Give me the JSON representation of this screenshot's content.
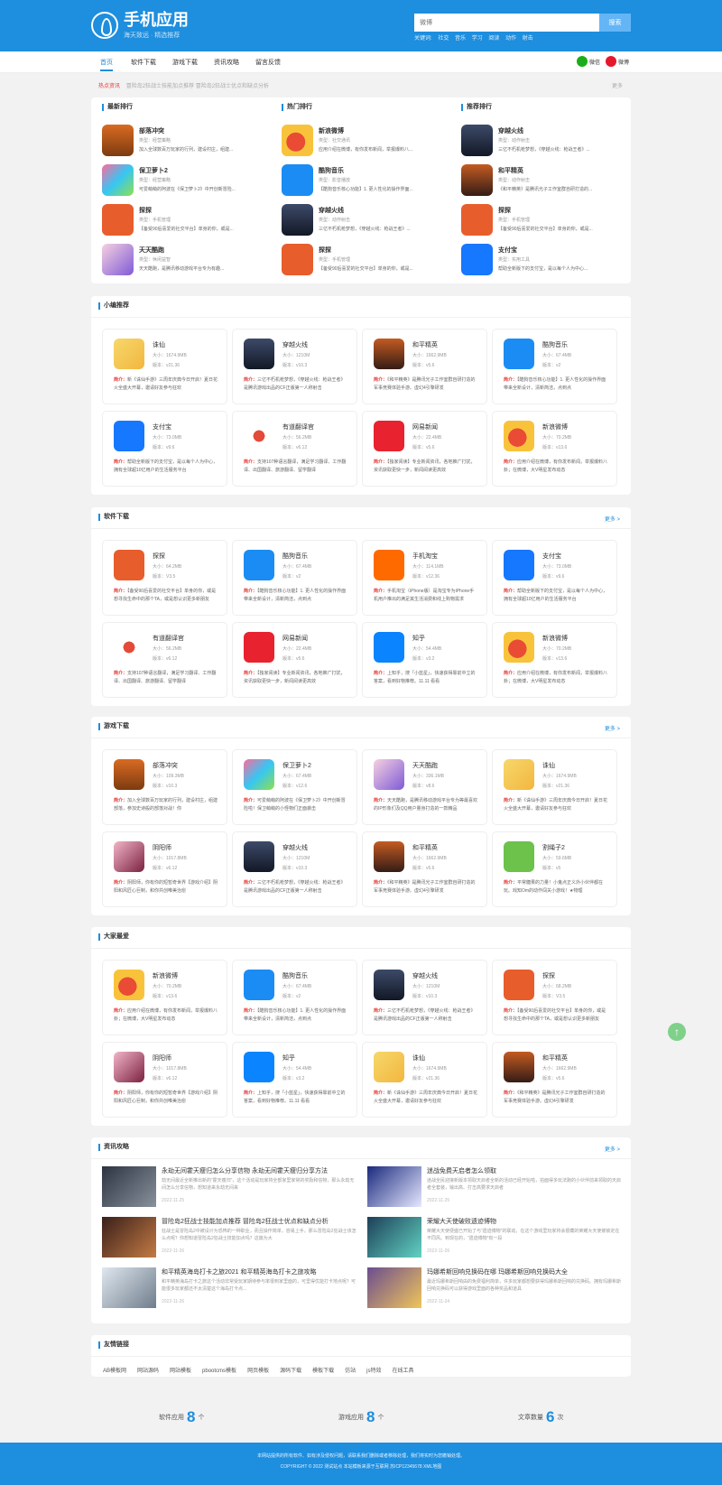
{
  "colors": {
    "brand": "#1e8ede",
    "accent": "#e53935",
    "panel": "#ffffff"
  },
  "header": {
    "title": "手机应用",
    "slogan": "海天致远 · 精选推荐",
    "search_placeholder": "微博",
    "search_button": "搜索",
    "hotwords_label": "关键词:",
    "hotwords": [
      "社交",
      "音乐",
      "学习",
      "阅读",
      "动作",
      "射击"
    ]
  },
  "nav": {
    "items": [
      "首页",
      "软件下载",
      "游戏下载",
      "资讯攻略",
      "留言反馈"
    ],
    "wechat_label": "微信",
    "weibo_label": "微博"
  },
  "notice": {
    "label": "热点资讯",
    "text": "冒险岛2狂战士技能加点推荐 冒险岛2狂战士优点和缺点分析",
    "more": "更多"
  },
  "rankings": {
    "columns": [
      {
        "title": "最新排行",
        "items": [
          {
            "name": "部落冲突",
            "category": "类型：经营策略",
            "desc": "加入全球数百万玩家的行列，建设村庄，组建..."
          },
          {
            "name": "保卫萝卜2",
            "category": "类型：经营策略",
            "desc": "可爱萌萌的阿波在《保卫萝卜2》中开创新冒险..."
          },
          {
            "name": "探探",
            "category": "类型：手机管理",
            "desc": "【备受90后喜爱的社交平台】单身的你，或是..."
          },
          {
            "name": "天天酷跑",
            "category": "类型：休闲益智",
            "desc": "天天酷跑，是腾讯移动游戏平台专为有趣..."
          }
        ]
      },
      {
        "title": "热门排行",
        "items": [
          {
            "name": "新浪微博",
            "category": "类型：社交通讯",
            "desc": "应用介绍在微博，有你发布新闻，举报爆料八..."
          },
          {
            "name": "酷狗音乐",
            "category": "类型：影音播放",
            "desc": "【酷狗音乐核心功能】1. 更人性化的操作界面..."
          },
          {
            "name": "穿越火线",
            "category": "类型：动作射击",
            "desc": "三亿不朽机枪梦想，《穿越火线：枪战王者》..."
          },
          {
            "name": "探探",
            "category": "类型：手机管理",
            "desc": "【备受90后喜爱的社交平台】单身的你，或是..."
          }
        ]
      },
      {
        "title": "推荐排行",
        "items": [
          {
            "name": "穿越火线",
            "category": "类型：动作射击",
            "desc": "三亿不朽机枪梦想，《穿越火线：枪战王者》..."
          },
          {
            "name": "和平精英",
            "category": "类型：动作射击",
            "desc": "《和平精英》是腾讯光子工作室群自研打造的..."
          },
          {
            "name": "探探",
            "category": "类型：手机管理",
            "desc": "【备受90后喜爱的社交平台】单身的你，或是..."
          },
          {
            "name": "支付宝",
            "category": "类型：实用工具",
            "desc": "帮助全新版下的支付宝，是以每个人为中心..."
          }
        ]
      }
    ]
  },
  "recommend": {
    "title": "小编推荐",
    "items": [
      {
        "name": "诛仙",
        "size": "大小：1674.9MB",
        "version": "版本：v21.36",
        "desc": "新《诛仙手游》三周年庆典今日开启！夏日花火全盛大开幕，邀请好友参与狂欢"
      },
      {
        "name": "穿越火线",
        "size": "大小：1210M",
        "version": "版本：v10.3",
        "desc": "三亿不朽机枪梦想，《穿越火线：枪战王者》是腾讯游戏出品的CF正版第一人称射击"
      },
      {
        "name": "和平精英",
        "size": "大小：1662.9MB",
        "version": "版本：v5.6",
        "desc": "《和平精英》是腾讯光子工作室群自研打造的军事竞赛体验手游。虚幻4引擎研发"
      },
      {
        "name": "酷狗音乐",
        "size": "大小：67.4MB",
        "version": "版本：v2",
        "desc": "【酷狗音乐核心功能】1. 更人性化的操作界面带来全新设计，清新简洁，点到点"
      },
      {
        "name": "支付宝",
        "size": "大小：73.0MB",
        "version": "版本：v9.6",
        "desc": "帮助全新版下的支付宝，是以每个人为中心，拥有全球超10亿用户的生活服务平台"
      },
      {
        "name": "有道翻译官",
        "size": "大小：56.2MB",
        "version": "版本：v6.12",
        "desc": "支持107种语言翻译，满足学习翻译、工作翻译、出国翻译、旅游翻译、留学翻译"
      },
      {
        "name": "网易新闻",
        "size": "大小：22.4MB",
        "version": "版本：v5.6",
        "desc": "【独家阅读】专业新闻资讯，各地推广打扰，资讯获取更快一步，新闻阅读更高效"
      },
      {
        "name": "新浪微博",
        "size": "大小：70.2MB",
        "version": "版本：v13.6",
        "desc": "应用介绍在微博，有你发布新闻，举报爆料八卦；在微博，大V明星发布动态"
      }
    ]
  },
  "software": {
    "title": "软件下载",
    "more": "更多 >",
    "items": [
      {
        "name": "探探",
        "size": "大小：64.2MB",
        "version": "版本：V3.5",
        "desc": "【备受90后喜爱的社交平台】单身的你，或是想寻找生命中的那个TA，或是想认识更多新朋友"
      },
      {
        "name": "酷狗音乐",
        "size": "大小：67.4MB",
        "version": "版本：v2",
        "desc": "【酷狗音乐核心功能】1. 更人性化的操作界面带来全新设计，清新简洁，点到点"
      },
      {
        "name": "手机淘宝",
        "size": "大小：114.1MB",
        "version": "版本：v12.36",
        "desc": "手机淘宝（iPhone版）是淘宝专为iPhone手机用户推出的满足其生活消费和线上购物需求"
      },
      {
        "name": "支付宝",
        "size": "大小：73.0MB",
        "version": "版本：v9.6",
        "desc": "帮助全新版下的支付宝，是以每个人为中心，拥有全球超10亿用户的生活服务平台"
      },
      {
        "name": "有道翻译官",
        "size": "大小：56.2MB",
        "version": "版本：v6.12",
        "desc": "支持107种语言翻译，满足学习翻译、工作翻译、出国翻译、旅游翻译、留学翻译"
      },
      {
        "name": "网易新闻",
        "size": "大小：22.4MB",
        "version": "版本：v5.6",
        "desc": "【独家阅读】专业新闻资讯，各地推广打扰，资讯获取更快一步，新闻阅读更高效"
      },
      {
        "name": "知乎",
        "size": "大小：54.4MB",
        "version": "版本：v3.2",
        "desc": "上知乎，搜「小蓝星」，快速获得靠前中立的答案，看到好物推荐。11.11 看看"
      },
      {
        "name": "新浪微博",
        "size": "大小：70.2MB",
        "version": "版本：v13.6",
        "desc": "应用介绍在微博，有你发布新闻，举报爆料八卦；在微博，大V明星发布动态"
      }
    ]
  },
  "games": {
    "title": "游戏下载",
    "more": "更多 >",
    "items": [
      {
        "name": "部落冲突",
        "size": "大小：109.3MB",
        "version": "版本：v10.3",
        "desc": "加入全球数百万玩家的行列，建设村庄，组建部落，参加史诗般的部落对战！你"
      },
      {
        "name": "保卫萝卜2",
        "size": "大小：67.4MB",
        "version": "版本：v12.6",
        "desc": "可爱萌萌的阿波在《保卫萝卜2》中开创新冒险啦！保卫萌萌的小怪物们正面袭击"
      },
      {
        "name": "天天酷跑",
        "size": "大小：336.1MB",
        "version": "版本：v8.6",
        "desc": "天天酷跑，是腾讯移动游戏平台专为等最喜欢的IP形象们及QQ用户量身打造的一款精品"
      },
      {
        "name": "诛仙",
        "size": "大小：1674.9MB",
        "version": "版本：v21.36",
        "desc": "新《诛仙手游》三周年庆典今日开启！夏日花火全盛大开幕，邀请好友参与狂欢"
      },
      {
        "name": "阴阳师",
        "size": "大小：1017.8MB",
        "version": "版本：v6.12",
        "desc": "阴阳师，你有你的短暂奇世界【游戏介绍】阴阳和风匠心巨制，和你共创唯美治愈"
      },
      {
        "name": "穿越火线",
        "size": "大小：1210M",
        "version": "版本：v10.3",
        "desc": "三亿不朽机枪梦想，《穿越火线：枪战王者》是腾讯游戏出品的CF正版第一人称射击"
      },
      {
        "name": "和平精英",
        "size": "大小：1662.9MB",
        "version": "版本：v5.6",
        "desc": "《和平精英》是腾讯光子工作室群自研打造的军事竞赛体验手游。虚幻4引擎研发"
      },
      {
        "name": "割绳子2",
        "size": "大小：59.6MB",
        "version": "版本：v5",
        "desc": "平常糖果的力量！小鬼点正义外小伙伴都在玩。戏知Om的动作闯关小游戏！★物理"
      }
    ]
  },
  "popular": {
    "title": "大家最爱",
    "items": [
      {
        "name": "新浪微博",
        "size": "大小：70.2MB",
        "version": "版本：v13.6",
        "desc": "应用介绍在微博，有你发布新闻，举报爆料八卦；在微博，大V明星发布动态"
      },
      {
        "name": "酷狗音乐",
        "size": "大小：67.4MB",
        "version": "版本：v2",
        "desc": "【酷狗音乐核心功能】1. 更人性化的操作界面带来全新设计，清新简洁，点到点"
      },
      {
        "name": "穿越火线",
        "size": "大小：1210M",
        "version": "版本：v10.3",
        "desc": "三亿不朽机枪梦想，《穿越火线：枪战王者》是腾讯游戏出品的CF正版第一人称射击"
      },
      {
        "name": "探探",
        "size": "大小：68.2MB",
        "version": "版本：V3.5",
        "desc": "【备受90后喜爱的社交平台】单身的你，或是想寻找生命中的那个TA，或是想认识更多新朋友"
      },
      {
        "name": "阴阳师",
        "size": "大小：1017.8MB",
        "version": "版本：v6.12",
        "desc": "阴阳师，你有你的短暂奇世界【游戏介绍】阴阳和风匠心巨制，和你共创唯美治愈"
      },
      {
        "name": "知乎",
        "size": "大小：54.4MB",
        "version": "版本：v3.2",
        "desc": "上知乎，搜「小蓝星」，快速获得靠前中立的答案，看到好物推荐。11.11 看看"
      },
      {
        "name": "诛仙",
        "size": "大小：1674.9MB",
        "version": "版本：v21.36",
        "desc": "新《诛仙手游》三周年庆典今日开启！夏日花火全盛大开幕，邀请好友参与狂欢"
      },
      {
        "name": "和平精英",
        "size": "大小：1662.9MB",
        "version": "版本：v5.6",
        "desc": "《和平精英》是腾讯光子工作室群自研打造的军事竞赛体验手游。虚幻4引擎研发"
      }
    ]
  },
  "news": {
    "title": "资讯攻略",
    "more": "更多 >",
    "items": [
      {
        "title": "永劫无间霍天瘦归怎么分享信物 永劫无间霍天瘦归分享方法",
        "desc": "劫无间最近全新推出新的“霍天瘦归”，这个活动是玩家将全部家里家常的奖励和信物，那么永劫无间怎么分享信物，想知道来永劫无间来",
        "date": "2022-11-25"
      },
      {
        "title": "迷战免费天启者怎么领取",
        "desc": "迷战全民迎接新版本领取天启者全新的活动已经开始啦，拍面得多玩法跑的小伙伴前来领取的天启者全套装，输出高、打击高要求天启者",
        "date": "2022-11-25"
      },
      {
        "title": "冒险岛2狂战士技能加点推荐 冒险岛2狂战士优点和缺点分析",
        "desc": "狂战士是冒险岛2中被设计为恐怖的一种职业，而且操作简单，容易上手。那么冒险岛2狂战士该怎么点呢？你想知道冒险岛2狂战士技能加点吗？这篇为大",
        "date": "2022-11-26"
      },
      {
        "title": "荣耀大天使破败遗迹博物",
        "desc": "荣耀大天使便盛已开始了与“遗迹博物”的联动，在这个游戏里玩家将会很藏的荣耀大天使被锁定在不同风。到现在的，“遗迹博物”有一段",
        "date": "2022-11-26"
      },
      {
        "title": "和平精英海岛打卡之旅2021 和平精英海岛打卡之旅攻略",
        "desc": "和平精英海岛打卡之旅这个活动非常受玩家期待参与率很到家里面的，可里得优能打卡地点呢？可能很多玩家都还不太清楚这个海岛打卡点...",
        "date": "2022-11-26"
      },
      {
        "title": "玛娜希斯回响兑换码在哪 玛娜希斯回响兑换码大全",
        "desc": "最近玛娜希斯回响由的免费福利简单，许多玩家都想要获得玛娜希斯回响的兑换码。拥有玛娜希斯回响兑换码可以获得游戏里面的各种奖品和道具",
        "date": "2022-11-24"
      }
    ]
  },
  "links": {
    "title": "友情链接",
    "items": [
      "AB模板网",
      "网站源码",
      "网站模板",
      "pbootcms模板",
      "网页模板",
      "源码下载",
      "模板下载",
      "仿站",
      "js特效",
      "在线工具"
    ]
  },
  "stats": [
    {
      "label": "软件应用",
      "count": "8",
      "unit": "个"
    },
    {
      "label": "游戏应用",
      "count": "8",
      "unit": "个"
    },
    {
      "label": "文章数量",
      "count": "6",
      "unit": "次"
    }
  ],
  "footer": {
    "line1": "本网站提供的所有软件、如有涉及侵权问题，请联系我们删除或者移除处理，我们将实时为您撤销处理。",
    "line2": "COPYRIGHT © 2022 测试站点 本站模板来源于互联网 苏ICP12345678 XML地图"
  },
  "icons": {
    "top": "↑"
  }
}
